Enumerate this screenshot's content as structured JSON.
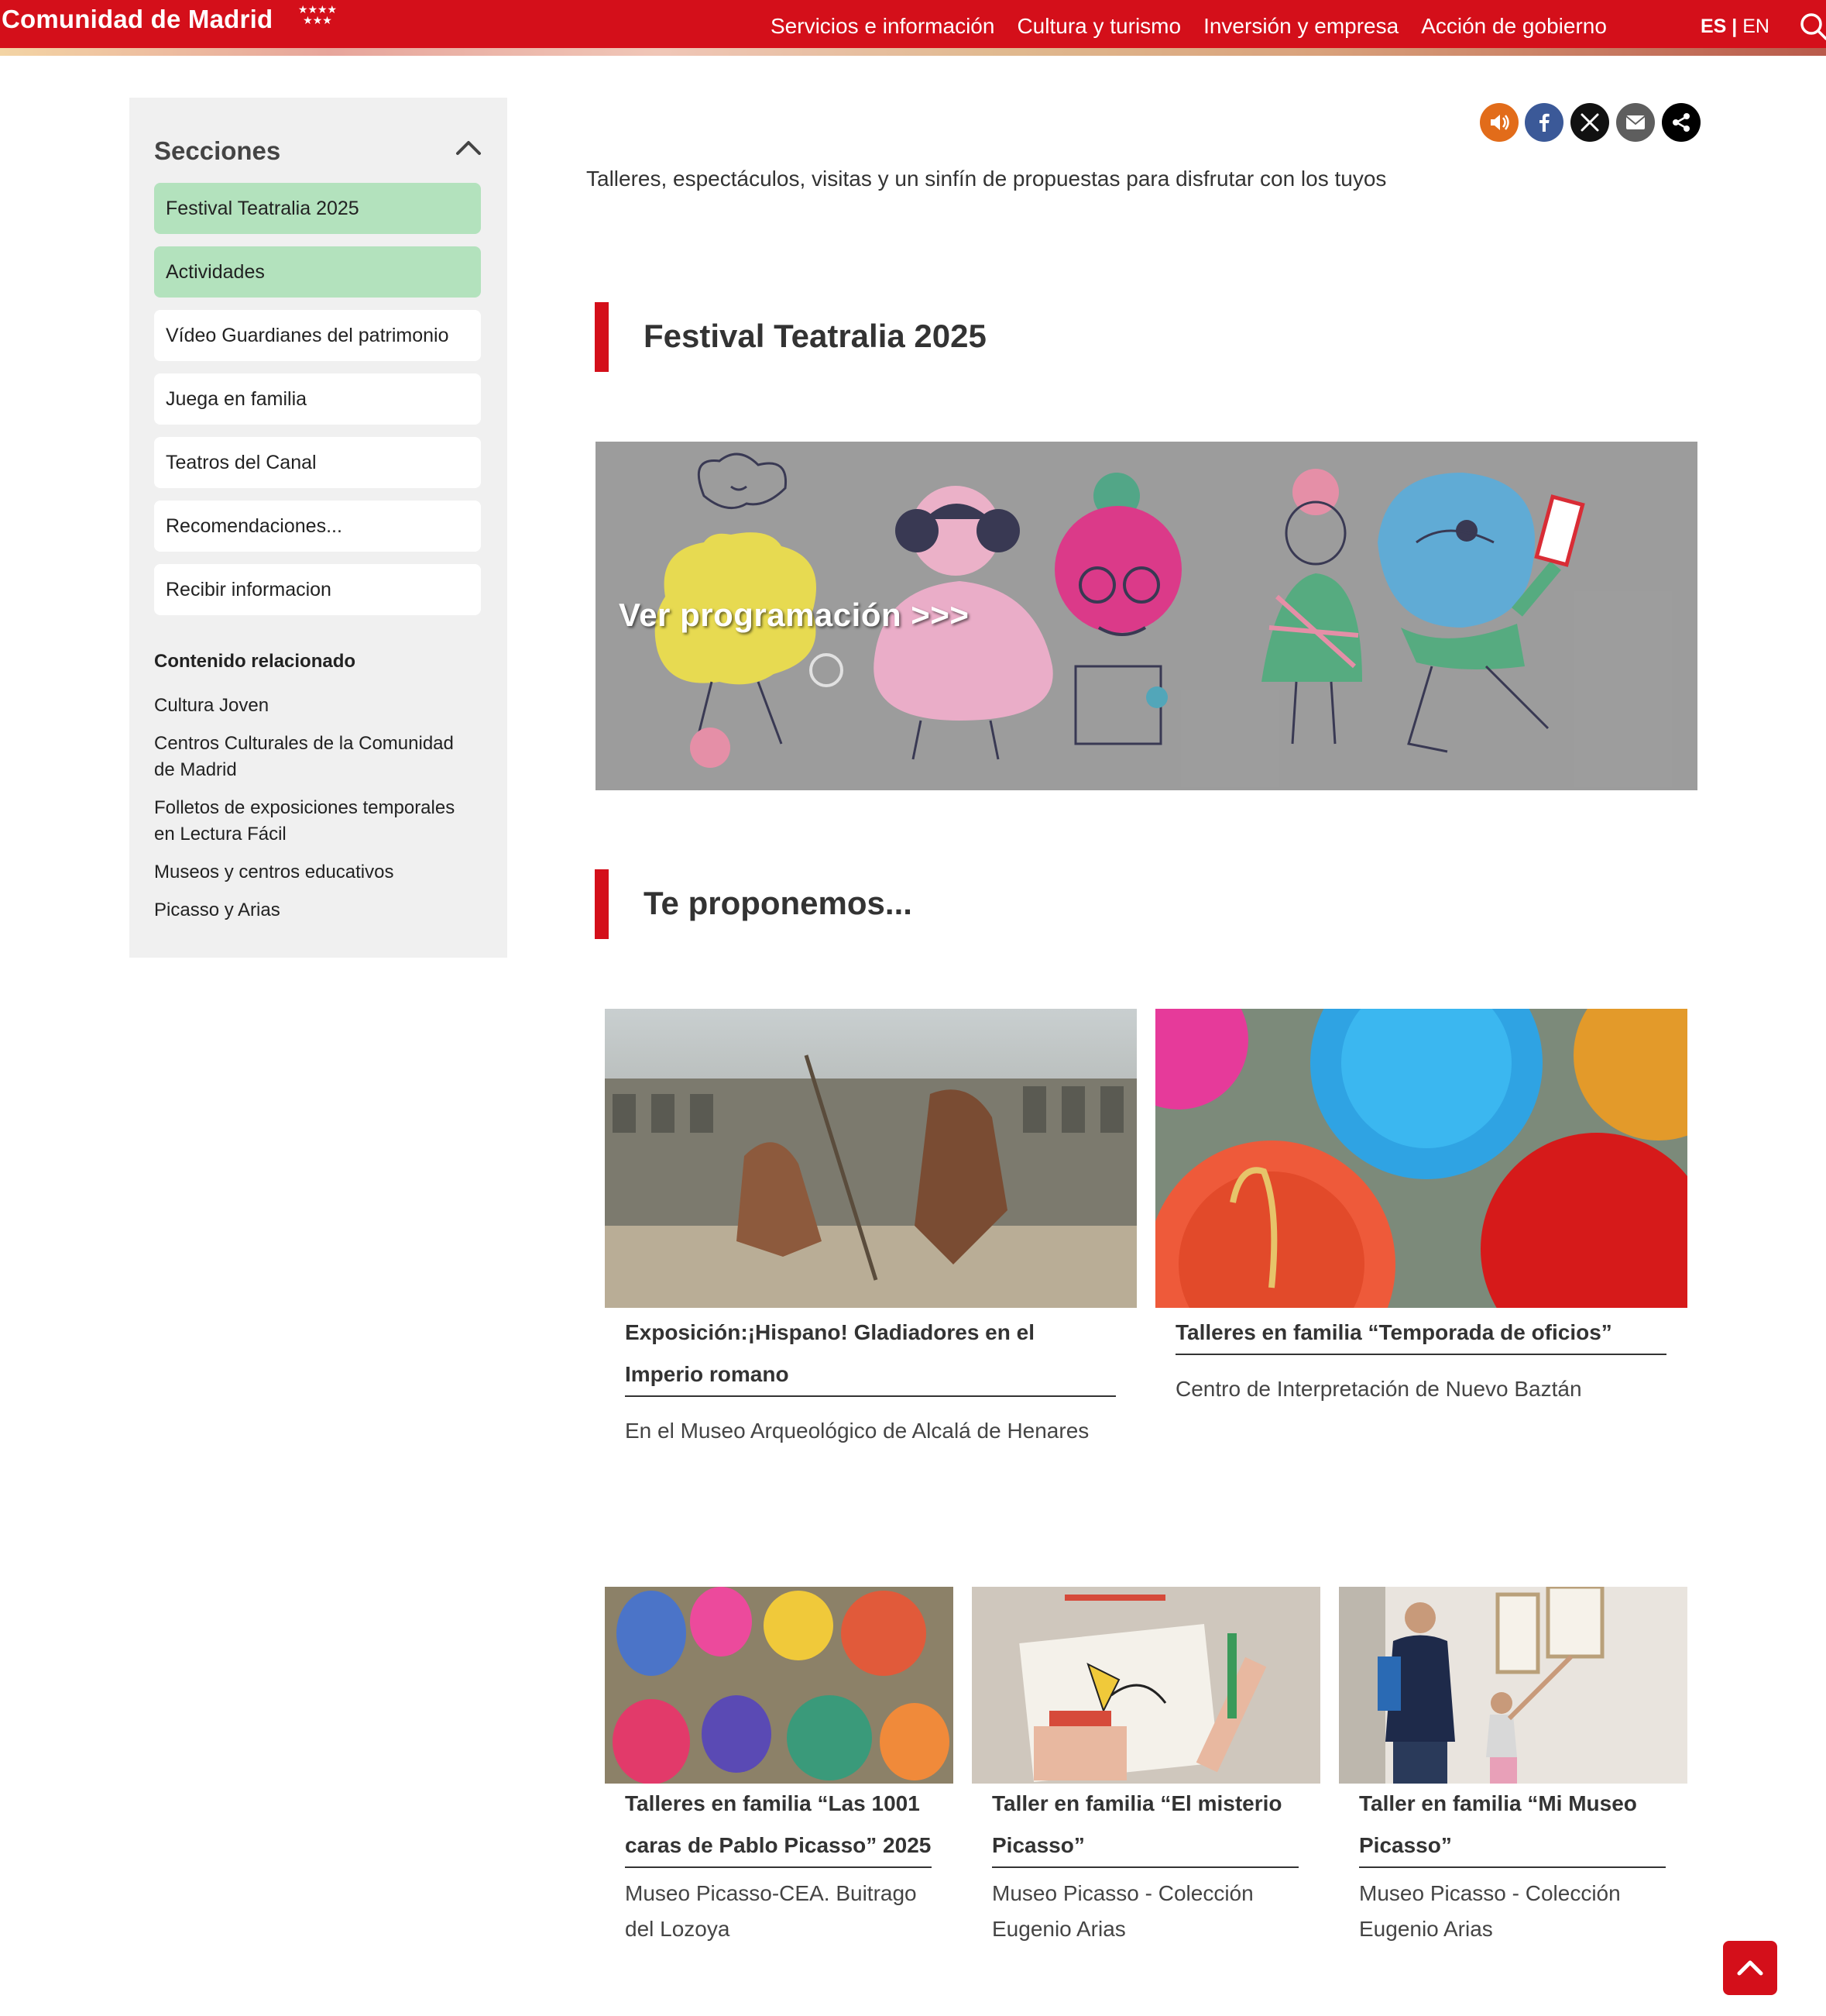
{
  "header": {
    "logo_text": "Comunidad de Madrid",
    "nav": [
      "Servicios e información",
      "Cultura y turismo",
      "Inversión y empresa",
      "Acción de gobierno"
    ],
    "lang_es": "ES",
    "lang_sep": " | ",
    "lang_en": "EN",
    "search_icon": "search-icon",
    "brand_color": "#d40f1a"
  },
  "sidebar": {
    "title": "Secciones",
    "items": [
      {
        "label": "Festival Teatralia 2025",
        "active": true
      },
      {
        "label": "Actividades",
        "active": true
      },
      {
        "label": "Vídeo Guardianes del patrimonio",
        "active": false
      },
      {
        "label": "Juega en familia",
        "active": false
      },
      {
        "label": "Teatros del Canal",
        "active": false
      },
      {
        "label": "Recomendaciones...",
        "active": false
      },
      {
        "label": "Recibir informacion",
        "active": false
      }
    ],
    "related_title": "Contenido relacionado",
    "related": [
      "Cultura Joven",
      "Centros Culturales de la Comunidad de Madrid",
      "Folletos de exposiciones temporales en Lectura Fácil",
      "Museos y centros educativos",
      "Picasso y Arias"
    ]
  },
  "share": {
    "icons": [
      "audio-icon",
      "facebook-icon",
      "x-icon",
      "email-icon",
      "share-icon"
    ]
  },
  "main": {
    "intro": "Talleres, espectáculos, visitas y un sinfín de propuestas para disfrutar con los tuyos",
    "section1_title": "Festival Teatralia 2025",
    "banner_text": "Ver programación >>>",
    "section2_title": "Te proponemos...",
    "cards_top": [
      {
        "title": "Exposición:¡Hispano! Gladiadores en el Imperio romano",
        "subtitle": "En el Museo Arqueológico de Alcalá de Henares"
      },
      {
        "title": "Talleres en familia “Temporada de oficios”",
        "subtitle": "Centro de Interpretación de Nuevo Baztán"
      }
    ],
    "cards_bottom": [
      {
        "title": "Talleres en familia “Las 1001 caras de Pablo Picasso” 2025",
        "subtitle": "Museo Picasso-CEA. Buitrago del Lozoya"
      },
      {
        "title": "Taller en familia “El misterio Picasso”",
        "subtitle": "Museo Picasso - Colección Eugenio Arias"
      },
      {
        "title": "Taller en familia “Mi Museo Picasso”",
        "subtitle": "Museo Picasso - Colección Eugenio Arias"
      }
    ]
  },
  "back_to_top_icon": "chevron-up-icon"
}
